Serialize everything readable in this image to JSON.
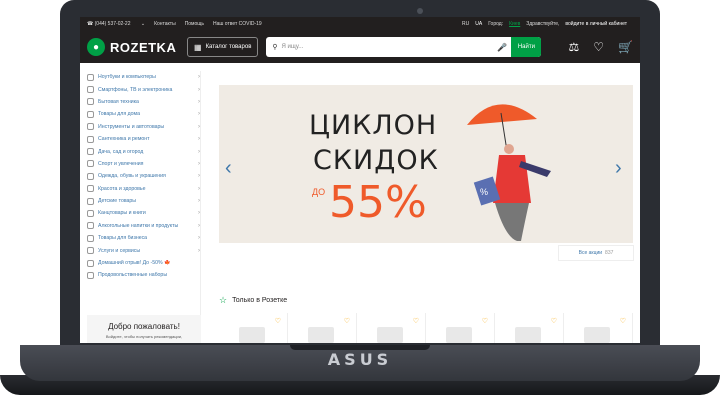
{
  "laptop": {
    "brand": "ASUS"
  },
  "topbar": {
    "phone": "(044) 537-02-22",
    "contacts": "Контакты",
    "help": "Помощь",
    "covid": "Наш ответ COVID-19",
    "lang_ru": "RU",
    "lang_ua": "UA",
    "city_label": "Город:",
    "city": "Киев",
    "greeting": "Здравствуйте,",
    "login": "войдите в личный кабинет"
  },
  "header": {
    "logo": "ROZETKA",
    "catalog": "Каталог товаров",
    "search_placeholder": "Я ищу...",
    "search_button": "Найти"
  },
  "sidebar": {
    "categories": [
      {
        "label": "Ноутбуки и компьютеры",
        "arrow": true
      },
      {
        "label": "Смартфоны, ТВ и электроника",
        "arrow": true
      },
      {
        "label": "Бытовая техника",
        "arrow": true
      },
      {
        "label": "Товары для дома",
        "arrow": true
      },
      {
        "label": "Инструменты и автотовары",
        "arrow": true
      },
      {
        "label": "Сантехника и ремонт",
        "arrow": true
      },
      {
        "label": "Дача, сад и огород",
        "arrow": true
      },
      {
        "label": "Спорт и увлечения",
        "arrow": true
      },
      {
        "label": "Одежда, обувь и украшения",
        "arrow": true
      },
      {
        "label": "Красота и здоровье",
        "arrow": true
      },
      {
        "label": "Детские товары",
        "arrow": true
      },
      {
        "label": "Канцтовары и книги",
        "arrow": true
      },
      {
        "label": "Алкогольные напитки и продукты",
        "arrow": true
      },
      {
        "label": "Товары для бизнеса",
        "arrow": true
      },
      {
        "label": "Услуги и сервисы",
        "arrow": true
      },
      {
        "label": "Домашний отрыв! До -50% 🍁",
        "arrow": false
      },
      {
        "label": "Продовольственные наборы",
        "arrow": false
      }
    ],
    "welcome_title": "Добро пожаловать!",
    "welcome_sub": "Войдите, чтобы получать рекомендации,"
  },
  "banner": {
    "line1": "ЦИКЛОН",
    "line2": "СКИДОК",
    "pre": "ДО",
    "percent": "55%",
    "promo_link": "Все акции",
    "promo_count": "837"
  },
  "section": {
    "title": "Только в Розетке"
  },
  "colors": {
    "accent": "#00a046",
    "dark": "#221f1f",
    "link": "#3e77aa",
    "sale": "#ef5a2a"
  }
}
